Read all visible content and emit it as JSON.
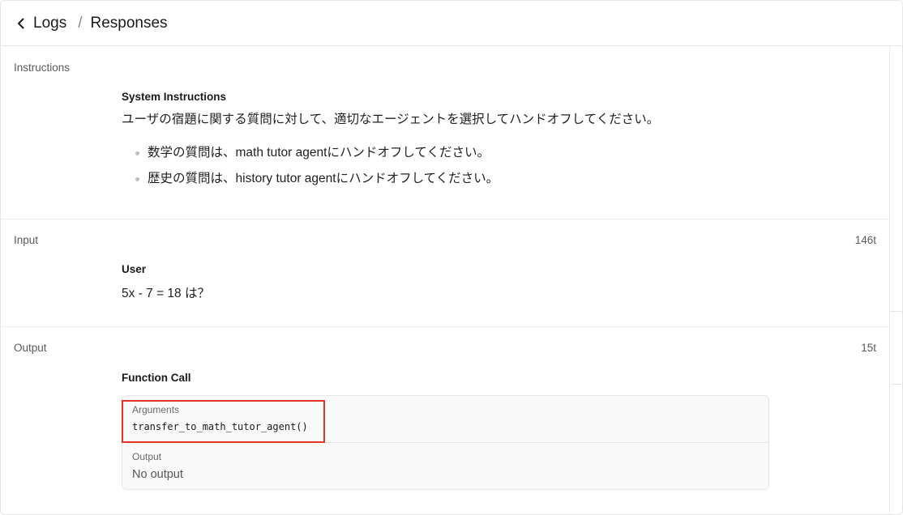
{
  "header": {
    "back_icon": "chevron-left-icon",
    "breadcrumb": [
      "Logs",
      "Responses"
    ],
    "separator": "/"
  },
  "instructions": {
    "label": "Instructions",
    "role": "System Instructions",
    "text": "ユーザの宿題に関する質問に対して、適切なエージェントを選択してハンドオフしてください。",
    "bullets": [
      "数学の質問は、math tutor agentにハンドオフしてください。",
      "歴史の質問は、history tutor agentにハンドオフしてください。"
    ]
  },
  "input": {
    "label": "Input",
    "tokens": "146t",
    "role": "User",
    "text": "5x - 7 = 18 は？"
  },
  "output": {
    "label": "Output",
    "tokens": "15t",
    "role": "Function Call",
    "arguments_label": "Arguments",
    "arguments_value": "transfer_to_math_tutor_agent()",
    "output_label": "Output",
    "output_value": "No output",
    "highlight_color": "#e53424"
  }
}
